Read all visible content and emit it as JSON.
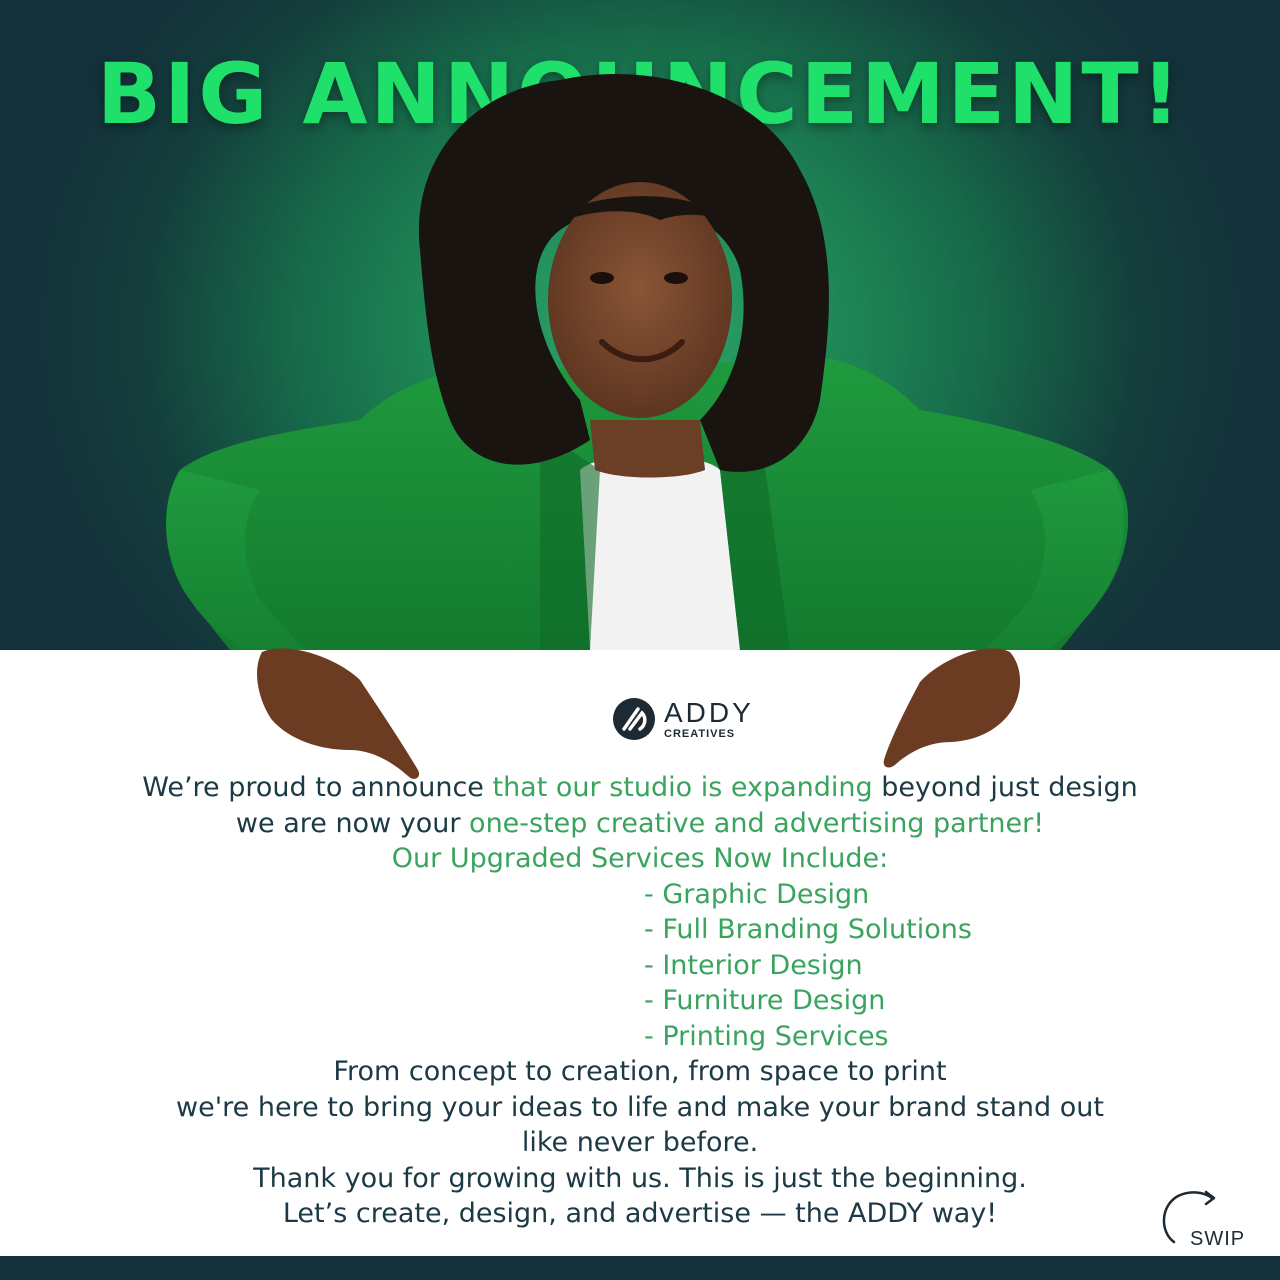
{
  "headline": "BIG ANNOUNCEMENT!",
  "brand": {
    "name": "ADDY",
    "tagline": "CREATIVES"
  },
  "intro": {
    "line1_a": "We’re proud to announce ",
    "line1_b": "that our studio is expanding ",
    "line1_c": "beyond just design",
    "line2_a": "we are now your ",
    "line2_b": "one-step creative and advertising partner!",
    "line3": "Our Upgraded Services Now Include:"
  },
  "services": [
    "- Graphic Design",
    "- Full Branding Solutions",
    "- Interior Design",
    "- Furniture Design",
    "- Printing Services"
  ],
  "closing": [
    "From concept to creation, from space to print",
    "we're here to bring your ideas to life and make your brand stand out",
    "like never before.",
    "Thank you for growing with us. This is just the beginning.",
    "Let’s create, design, and advertise — the ADDY way!"
  ],
  "swipe_label": "SWIP",
  "colors": {
    "headline": "#1fe06a",
    "accent_text": "#3aa45e",
    "body_text": "#1c3a45",
    "hero_dark": "#13313a",
    "hero_light": "#2fa56a"
  }
}
